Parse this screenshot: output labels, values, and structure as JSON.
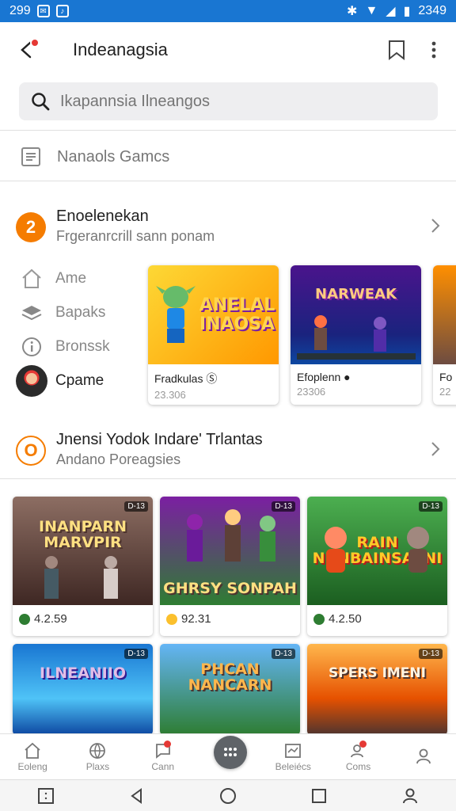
{
  "status_bar": {
    "time": "299",
    "right_time": "2349"
  },
  "app_bar": {
    "title": "Indeanagsia"
  },
  "search": {
    "placeholder": "Ikapannsia Ilneangos"
  },
  "games_row": {
    "label": "Nanaols Gamcs"
  },
  "section1": {
    "badge": "2",
    "title": "Enoelenekan",
    "subtitle": "Frgeranrcrill sann ponam"
  },
  "sidenav": [
    {
      "label": "Ame",
      "icon": "home-icon"
    },
    {
      "label": "Bapaks",
      "icon": "layers-icon"
    },
    {
      "label": "Bronssk",
      "icon": "info-icon"
    },
    {
      "label": "Cpame",
      "icon": "avatar"
    }
  ],
  "featured": [
    {
      "name": "Fradkulas Ⓢ",
      "stat": "23.306",
      "art": "ANELAL\nINAOSA",
      "colors": [
        "#fbc02d",
        "#ff9800"
      ]
    },
    {
      "name": "Efoplenn ●",
      "stat": "23306",
      "art": "NARWEAK",
      "colors": [
        "#4a148c",
        "#1a237e"
      ]
    },
    {
      "name": "Fo",
      "stat": "22",
      "art": "",
      "colors": [
        "#ff8f00",
        "#6d4c41"
      ]
    }
  ],
  "section2": {
    "badge": "O",
    "title": "Jnensi Yodok Indare' Trlantas",
    "subtitle": "Andano Poreagsies"
  },
  "grid": [
    {
      "art": "INANPARN\nMARVPIR",
      "tag": "D-13",
      "rating": "4.2.59",
      "dot": "green",
      "colors": [
        "#6d4c41",
        "#3e2723"
      ]
    },
    {
      "art": "GHRSY SONPAH",
      "tag": "D-13",
      "rating": "92.31",
      "dot": "gold",
      "colors": [
        "#7b1fa2",
        "#1b5e20"
      ]
    },
    {
      "art": "RAIN\nNUNBAINSAENI",
      "tag": "D-13",
      "rating": "4.2.50",
      "dot": "green",
      "colors": [
        "#388e3c",
        "#1b5e20"
      ]
    },
    {
      "art": "ILNEANIIO",
      "tag": "D-13",
      "rating": "",
      "dot": "",
      "colors": [
        "#1565c0",
        "#0d47a1"
      ]
    },
    {
      "art": "PHCAN\nNANCARN",
      "tag": "D-13",
      "rating": "",
      "dot": "",
      "colors": [
        "#1e88e5",
        "#2e7d32"
      ]
    },
    {
      "art": "SPERS IMENI",
      "tag": "D-13",
      "rating": "",
      "dot": "",
      "colors": [
        "#ef6c00",
        "#5d4037"
      ]
    }
  ],
  "bottom_nav": [
    {
      "label": "Eoleng",
      "icon": "home-icon",
      "dot": false
    },
    {
      "label": "Plaxs",
      "icon": "globe-icon",
      "dot": false
    },
    {
      "label": "Cann",
      "icon": "chat-icon",
      "dot": true
    },
    {
      "label": "",
      "icon": "",
      "dot": false
    },
    {
      "label": "Beleiécs",
      "icon": "chart-icon",
      "dot": false
    },
    {
      "label": "Coms",
      "icon": "people-icon",
      "dot": true
    },
    {
      "label": "",
      "icon": "profile-icon",
      "dot": false
    }
  ]
}
